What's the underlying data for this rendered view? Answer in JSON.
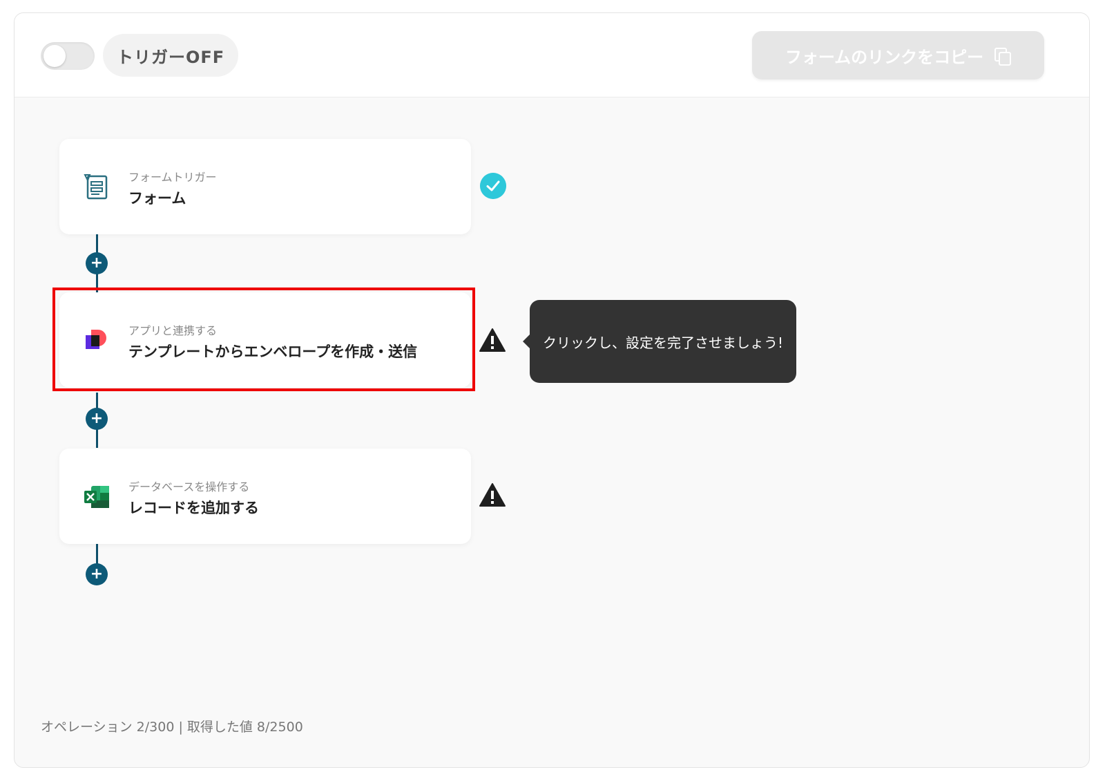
{
  "toolbar": {
    "trigger_status": "トリガーOFF",
    "copy_link_label": "フォームのリンクをコピー"
  },
  "steps": [
    {
      "subtitle": "フォームトリガー",
      "title": "フォーム",
      "status": "complete",
      "icon": "form-icon"
    },
    {
      "subtitle": "アプリと連携する",
      "title": "テンプレートからエンベロープを作成・送信",
      "status": "warning",
      "icon": "docusign-app-icon"
    },
    {
      "subtitle": "データベースを操作する",
      "title": "レコードを追加する",
      "status": "warning",
      "icon": "excel-icon"
    }
  ],
  "tooltip": {
    "text": "クリックし、設定を完了させましょう!"
  },
  "footer": {
    "text": "オペレーション 2/300 | 取得した値 8/2500"
  },
  "colors": {
    "connector": "#0e4f6a",
    "check": "#2ec8da",
    "highlight": "#ee0000",
    "tooltip_bg": "#333333"
  }
}
